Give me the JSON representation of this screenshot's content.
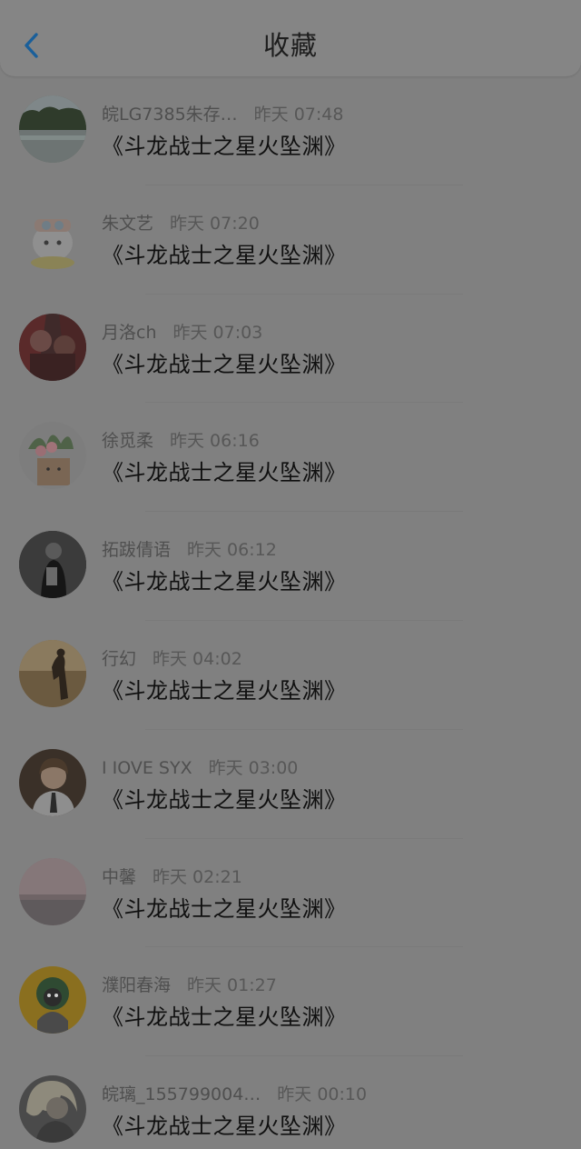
{
  "header": {
    "title": "收藏"
  },
  "items": [
    {
      "name": "皖LG7385朱存…",
      "time": "昨天 07:48",
      "title": "《斗龙战士之星火坠渊》"
    },
    {
      "name": "朱文艺",
      "time": "昨天 07:20",
      "title": "《斗龙战士之星火坠渊》"
    },
    {
      "name": "月洛ch",
      "time": "昨天 07:03",
      "title": "《斗龙战士之星火坠渊》"
    },
    {
      "name": "徐觅柔",
      "time": "昨天 06:16",
      "title": "《斗龙战士之星火坠渊》"
    },
    {
      "name": "拓跋倩语",
      "time": "昨天 06:12",
      "title": "《斗龙战士之星火坠渊》"
    },
    {
      "name": "行幻",
      "time": "昨天 04:02",
      "title": "《斗龙战士之星火坠渊》"
    },
    {
      "name": "I IOVE SYX",
      "time": "昨天 03:00",
      "title": "《斗龙战士之星火坠渊》"
    },
    {
      "name": "中馨",
      "time": "昨天 02:21",
      "title": "《斗龙战士之星火坠渊》"
    },
    {
      "name": "濮阳春海",
      "time": "昨天 01:27",
      "title": "《斗龙战士之星火坠渊》"
    },
    {
      "name": "皖璃_155799004…",
      "time": "昨天 00:10",
      "title": "《斗龙战士之星火坠渊》"
    }
  ],
  "colors": {
    "overlay_background": "#808080",
    "back_arrow": "#1a5f9a",
    "title_text": "#1e1e1e"
  }
}
